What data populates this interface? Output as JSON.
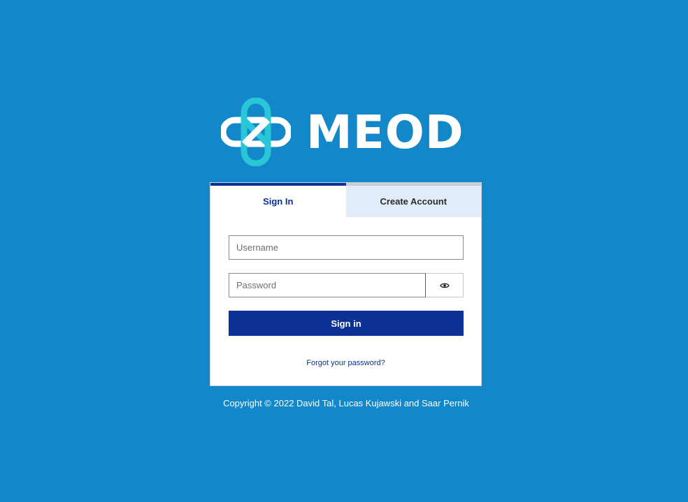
{
  "brand": {
    "name": "MEOD",
    "logo_icon": "infinity-knot-logo",
    "logo_colors": [
      "#ffffff",
      "#29c6d8"
    ]
  },
  "tabs": [
    {
      "label": "Sign In",
      "active": true
    },
    {
      "label": "Create Account",
      "active": false
    }
  ],
  "form": {
    "username_placeholder": "Username",
    "password_placeholder": "Password",
    "toggle_icon": "eye-icon",
    "submit_label": "Sign in",
    "forgot_label": "Forgot your password?"
  },
  "footer": {
    "copyright": "Copyright © 2022 David Tal, Lucas Kujawski and Saar Pernik"
  },
  "colors": {
    "background": "#1287c9",
    "primary": "#0b3194",
    "inactive_tab": "#e1ecfa"
  }
}
